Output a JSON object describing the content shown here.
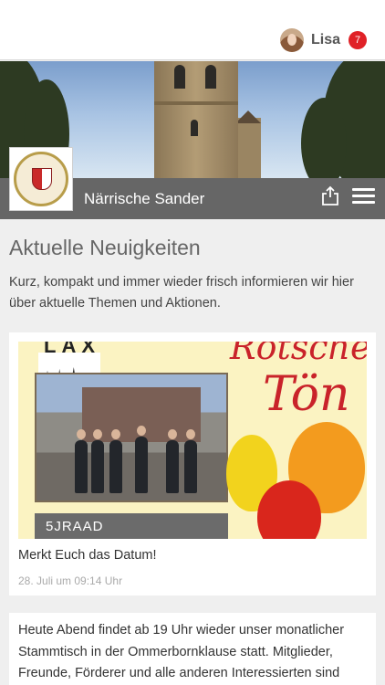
{
  "header": {
    "user_name": "Lisa",
    "notification_count": "7"
  },
  "club": {
    "name": "Närrische Sander"
  },
  "news": {
    "heading": "Aktuelle Neuigkeiten",
    "intro": "Kurz, kompakt und immer wieder frisch informieren wir hier über aktuelle Themen und Aktionen.",
    "posts": [
      {
        "title": "Merkt Euch das Datum!",
        "date": "28. Juli um 09:14 Uhr",
        "image_text": {
          "band": "LAX",
          "script_top": "Rotsche",
          "script_main": "Tön",
          "label": "5JRAAD"
        }
      },
      {
        "text": "Heute Abend findet ab 19 Uhr wieder unser monatlicher Stammtisch in der Ommerbornklause statt. Mitglieder, Freunde, Förderer und alle anderen Interessierten sind"
      }
    ]
  },
  "icons": {
    "share": "share-icon",
    "menu": "hamburger-menu-icon"
  },
  "colors": {
    "title_bar": "#666666",
    "badge": "#e02127",
    "background": "#efefef"
  }
}
